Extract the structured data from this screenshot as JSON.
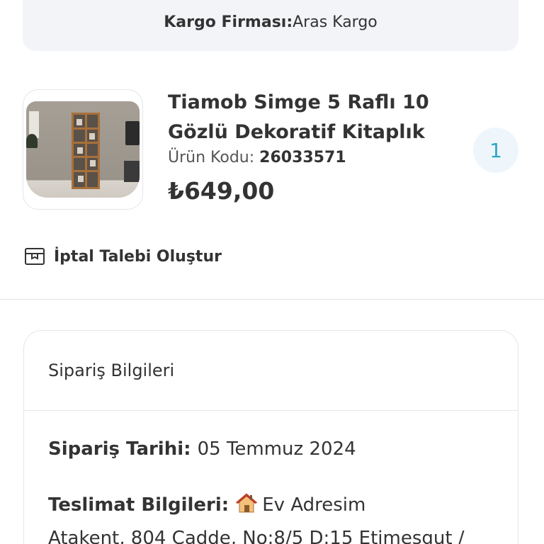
{
  "shipping": {
    "label": "Kargo Firması:",
    "value": "Aras Kargo"
  },
  "product": {
    "image_icon": "bookshelf-photo",
    "title": "Tiamob Simge 5 Raflı 10 Gözlü Dekoratif Kitaplık",
    "code_label": "Ürün Kodu: ",
    "code_value": "26033571",
    "price": "₺649,00",
    "quantity": "1"
  },
  "cancel": {
    "label": "İptal Talebi Oluştur",
    "icon": "cancel-request-box-icon"
  },
  "order_info": {
    "title": "Sipariş Bilgileri",
    "date_label": "Sipariş Tarihi: ",
    "date_value": "05 Temmuz 2024",
    "delivery_label": "Teslimat Bilgileri: ",
    "delivery_icon": "house-icon",
    "delivery_value": "Ev Adresim",
    "address": "Atakent, 804 Cadde, No:8/5 D:15 Etimesgut /"
  },
  "colors": {
    "accent": "#2fa6c8",
    "banner_bg": "#f2f4f7",
    "text": "#333333"
  }
}
